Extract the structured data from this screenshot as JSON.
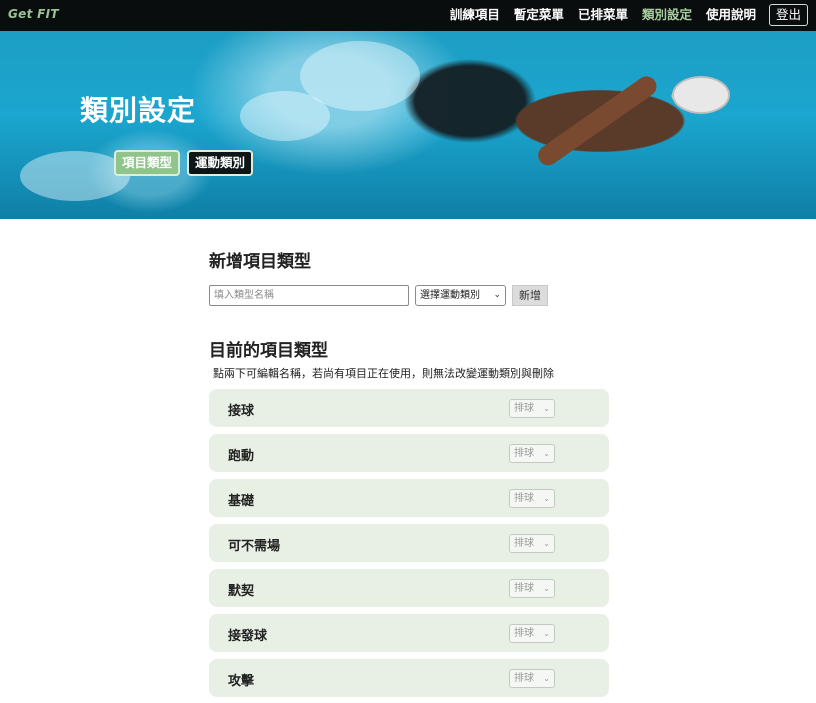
{
  "navbar": {
    "brand": "Get FIT",
    "links": [
      {
        "label": "訓練項目",
        "active": false
      },
      {
        "label": "暫定菜單",
        "active": false
      },
      {
        "label": "已排菜單",
        "active": false
      },
      {
        "label": "類別設定",
        "active": true
      },
      {
        "label": "使用說明",
        "active": false
      }
    ],
    "logout_label": "登出"
  },
  "hero": {
    "title": "類別設定",
    "tabs": [
      {
        "label": "項目類型",
        "active": true
      },
      {
        "label": "運動類別",
        "active": false
      }
    ]
  },
  "add_section": {
    "title": "新增項目類型",
    "input_placeholder": "填入類型名稱",
    "input_value": "",
    "select_label": "選擇運動類別",
    "add_button_label": "新增"
  },
  "current_section": {
    "title": "目前的項目類型",
    "hint": "點兩下可編輯名稱，若尚有項目正在使用，則無法改變運動類別與刪除",
    "items": [
      {
        "name": "接球",
        "category": "排球"
      },
      {
        "name": "跑動",
        "category": "排球"
      },
      {
        "name": "基礎",
        "category": "排球"
      },
      {
        "name": "可不需場",
        "category": "排球"
      },
      {
        "name": "默契",
        "category": "排球"
      },
      {
        "name": "接發球",
        "category": "排球"
      },
      {
        "name": "攻擊",
        "category": "排球"
      }
    ]
  },
  "colors": {
    "navbar_bg": "#0a0d0e",
    "brand": "#9bc295",
    "active_nav": "#a9cfa1",
    "tab_active_bg": "#8fc48a",
    "tab_inactive_bg": "#0d1516",
    "row_bg": "#e8f0e5"
  },
  "icons": {
    "dropdown": "chevron-down-icon"
  }
}
